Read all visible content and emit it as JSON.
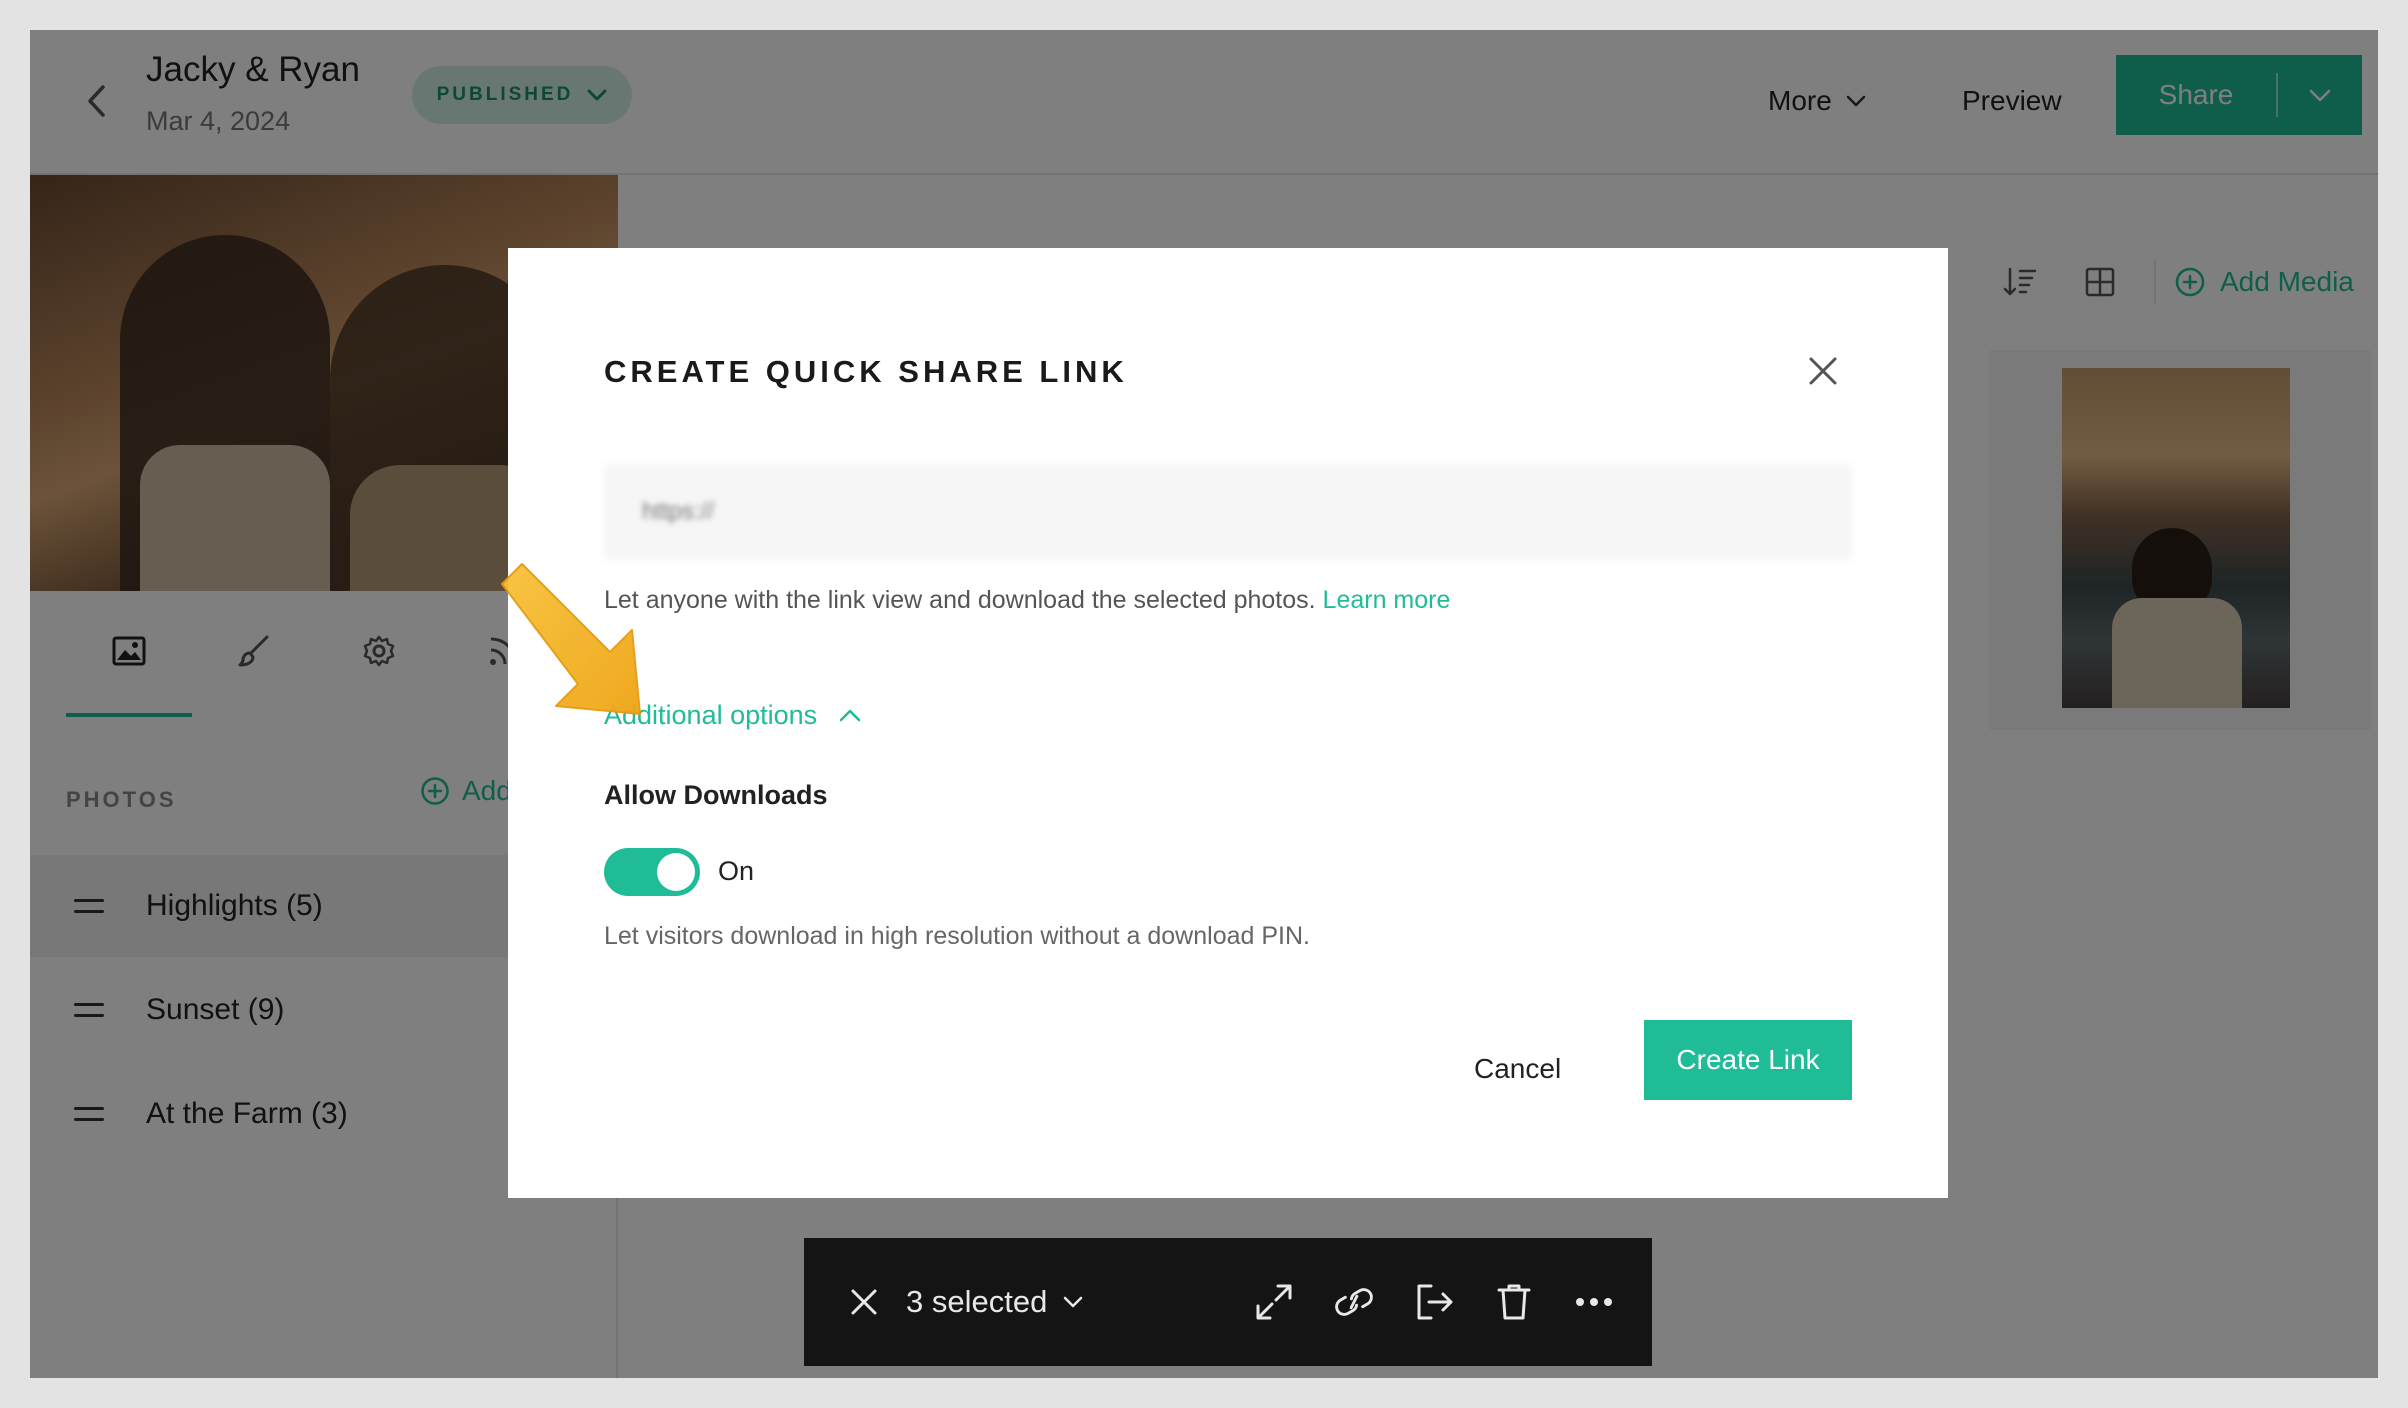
{
  "header": {
    "title": "Jacky & Ryan",
    "date": "Mar 4, 2024",
    "status": "PUBLISHED",
    "more_label": "More",
    "preview_label": "Preview",
    "share_label": "Share"
  },
  "sidebar": {
    "section_label": "PHOTOS",
    "add_label": "Add",
    "sets": [
      {
        "label": "Highlights (5)"
      },
      {
        "label": "Sunset (9)"
      },
      {
        "label": "At the Farm (3)"
      }
    ],
    "tab_icons": [
      "image-icon",
      "brush-icon",
      "gear-icon",
      "rss-icon"
    ]
  },
  "main": {
    "add_media_label": "Add Media"
  },
  "selection_bar": {
    "count_label": "3 selected"
  },
  "modal": {
    "title": "CREATE QUICK SHARE LINK",
    "link_placeholder": "https://",
    "help_text": "Let anyone with the link view and download the selected photos.",
    "learn_more": "Learn more",
    "additional_options": "Additional options",
    "allow_downloads_label": "Allow Downloads",
    "toggle_state": "On",
    "toggle_description": "Let visitors download in high resolution without a download PIN.",
    "cancel_label": "Cancel",
    "create_label": "Create Link"
  },
  "colors": {
    "accent": "#1fbc97",
    "toolbar_bg": "#141414",
    "arrow": "#f5b324"
  }
}
